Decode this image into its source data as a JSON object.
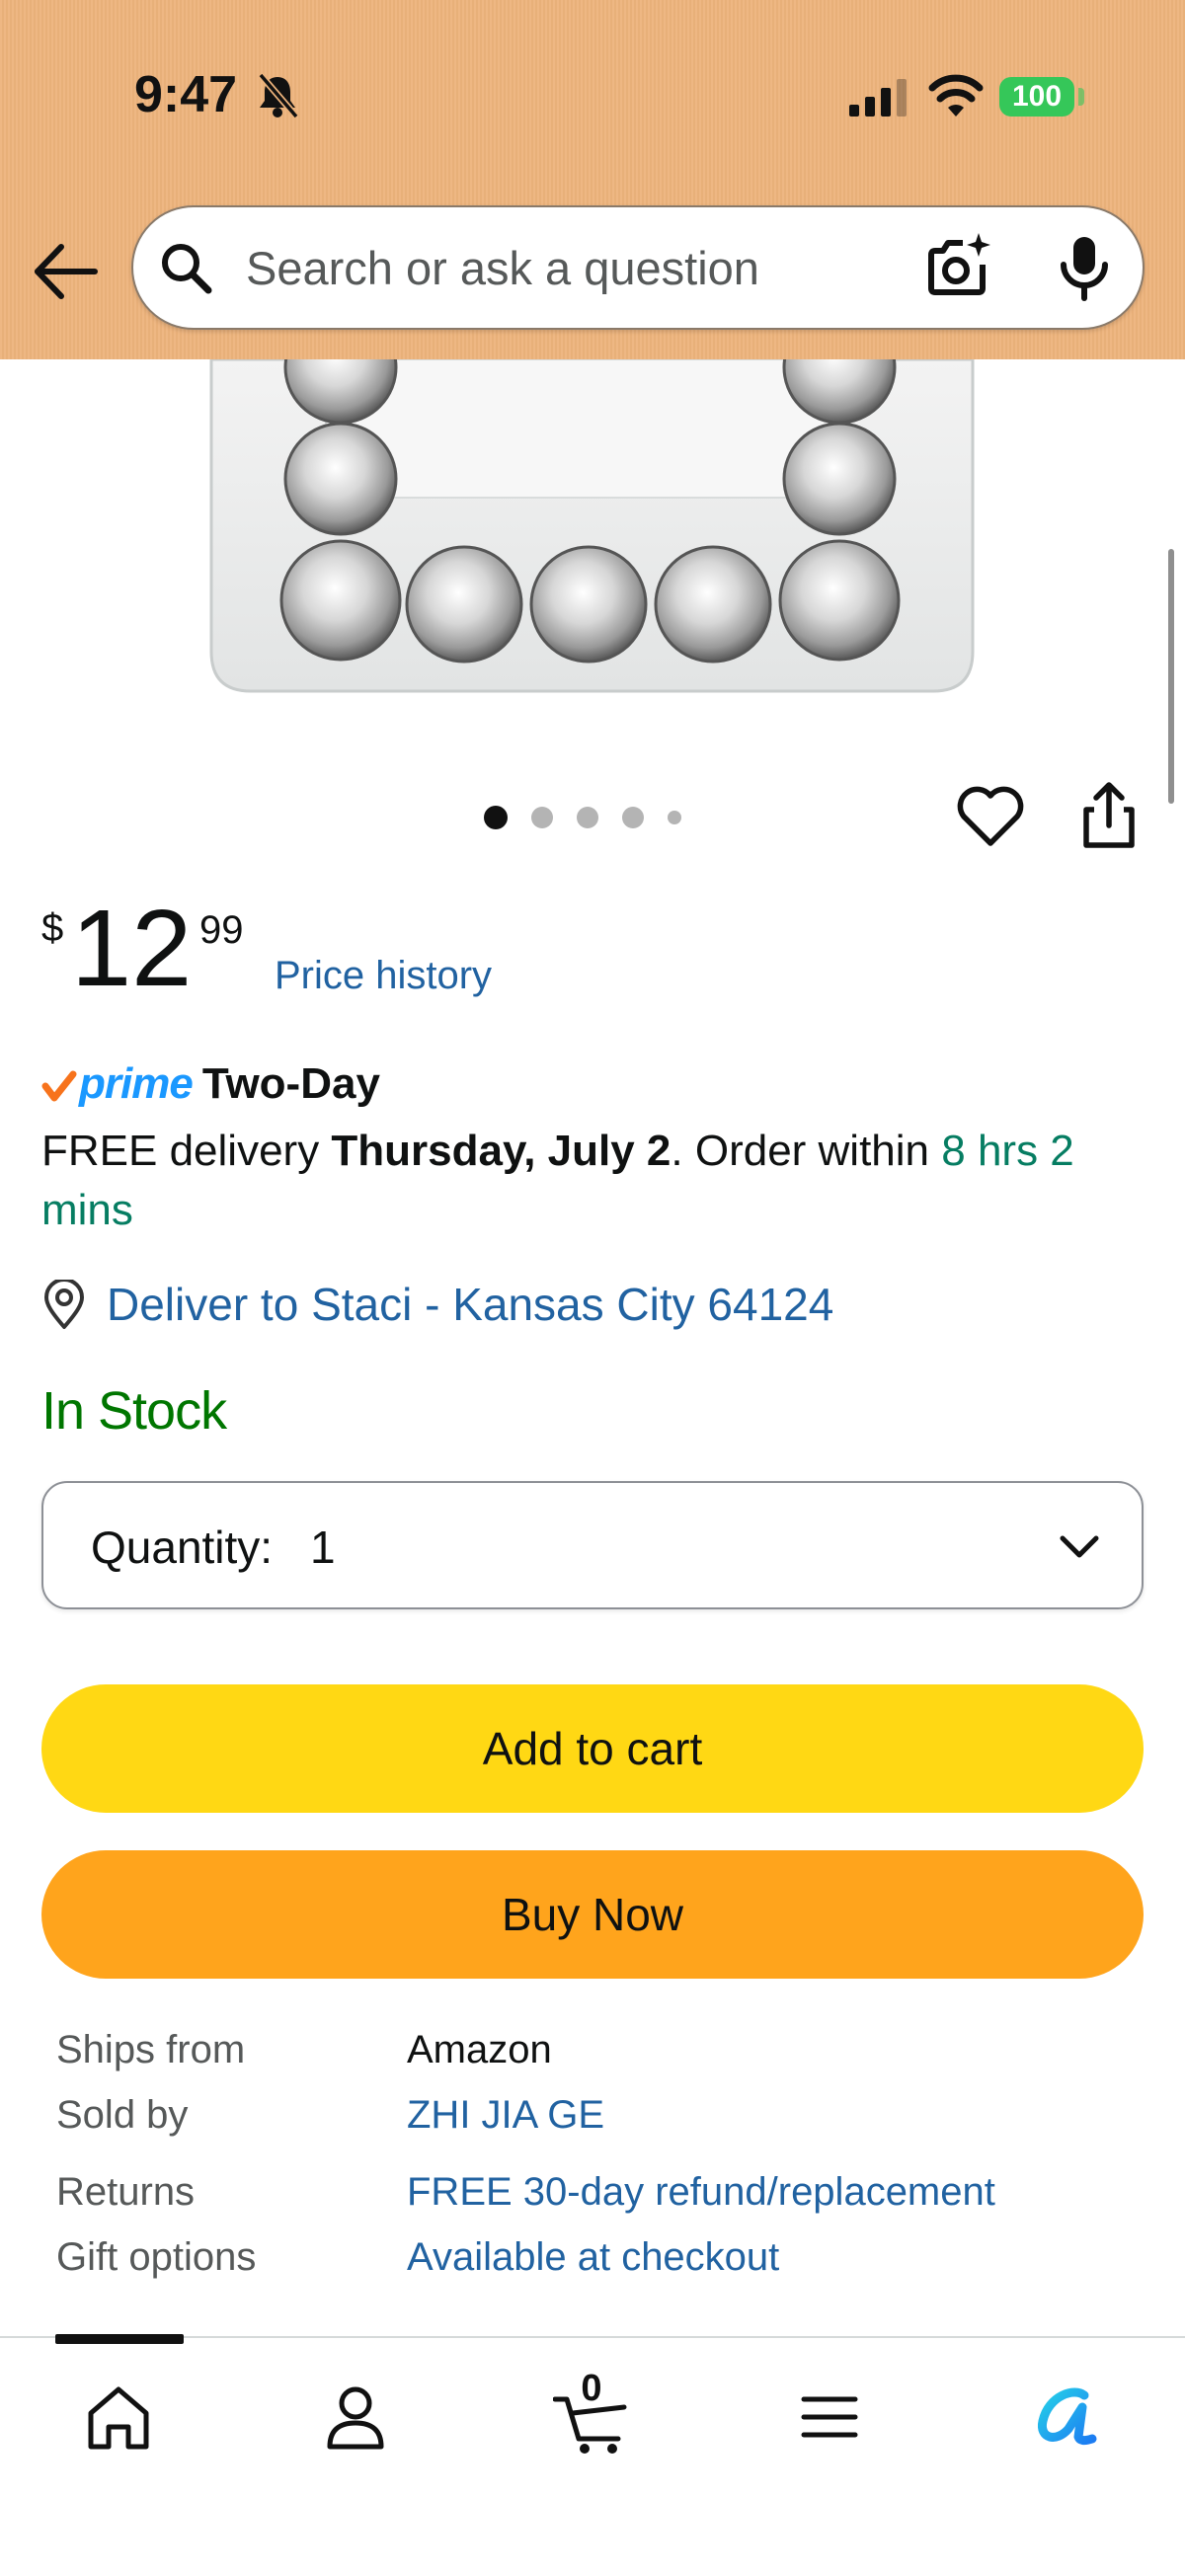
{
  "status_bar": {
    "time": "9:47",
    "battery": "100"
  },
  "search": {
    "placeholder": "Search or ask a question"
  },
  "gallery": {
    "dot_count": 5,
    "active_dot": 1
  },
  "price": {
    "symbol": "$",
    "whole": "12",
    "fraction": "99",
    "history_link": "Price history"
  },
  "prime": {
    "brand": "prime",
    "speed": "Two-Day"
  },
  "delivery": {
    "prefix": "FREE delivery ",
    "date": "Thursday, July 2",
    "middle": ". Order within ",
    "countdown": "8 hrs 2 mins"
  },
  "deliver_to": "Deliver to Staci - Kansas City 64124",
  "stock": "In Stock",
  "quantity": {
    "label": "Quantity:",
    "value": "1"
  },
  "buttons": {
    "add_to_cart": "Add to cart",
    "buy_now": "Buy Now"
  },
  "details": [
    {
      "key": "Ships from",
      "value": "Amazon",
      "link": false
    },
    {
      "key": "Sold by",
      "value": "ZHI JIA GE",
      "link": true
    },
    {
      "key": "Returns",
      "value": "FREE 30-day refund/replacement",
      "link": true
    },
    {
      "key": "Gift options",
      "value": "Available at checkout",
      "link": true
    }
  ],
  "bottom_nav": {
    "items": [
      "home-icon",
      "account-icon",
      "cart-icon",
      "menu-icon",
      "rufus-icon"
    ],
    "cart_count": "0"
  },
  "colors": {
    "header": "#edb37b",
    "link": "#2162a1",
    "in_stock": "#007600",
    "add_to_cart": "#ffd814",
    "buy_now": "#ffa41c"
  }
}
